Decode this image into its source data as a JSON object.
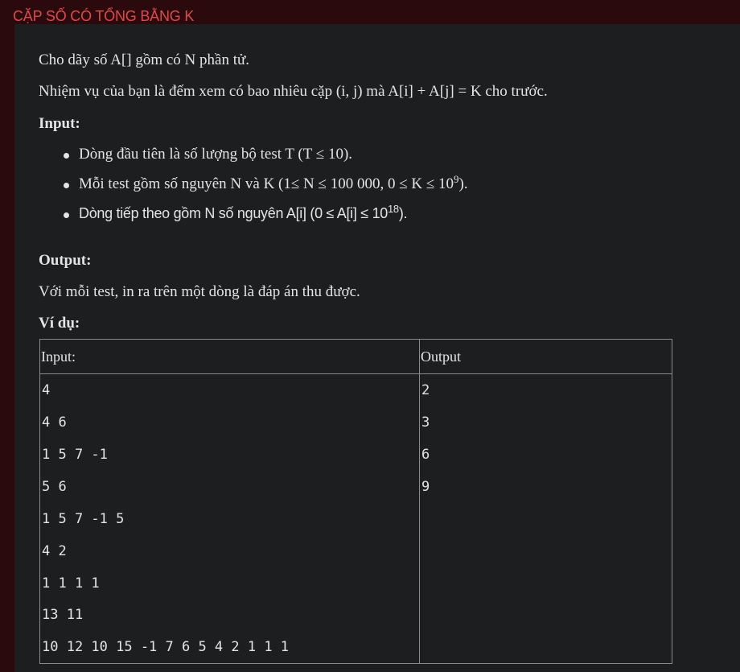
{
  "title": "CẶP SỐ CÓ TỔNG BẰNG K",
  "intro": "Cho dãy số A[] gồm có N phần tử.",
  "task": "Nhiệm vụ của bạn là đếm xem có bao nhiêu cặp (i, j) mà A[i] + A[j] = K cho trước.",
  "input_heading": "Input:",
  "input_items": {
    "item1": "Dòng đầu tiên là số lượng bộ test T (T ≤ 10).",
    "item2_main": "Mỗi test gồm số nguyên N và K (1≤ N ≤ 100 000, 0 ≤ K ≤ 10",
    "item2_sup": "9",
    "item2_end": ").",
    "item3_main": "Dòng tiếp theo gồm N số nguyên A[i] (0 ≤ A[i] ≤ 10",
    "item3_sup": "18",
    "item3_end": ")."
  },
  "output_heading": "Output:",
  "output_text": "Với mỗi test, in ra trên một dòng là đáp án thu được.",
  "example_heading": "Ví dụ:",
  "example_table": {
    "headers": [
      "Input:",
      "Output"
    ],
    "input_lines": [
      "4",
      "4 6",
      "1 5 7 -1",
      "5 6",
      "1 5 7 -1 5",
      "4 2",
      "1 1 1 1",
      "13 11",
      "10 12 10 15 -1 7 6 5 4 2 1 1 1"
    ],
    "output_lines": [
      "2",
      "3",
      "6",
      "9"
    ]
  }
}
